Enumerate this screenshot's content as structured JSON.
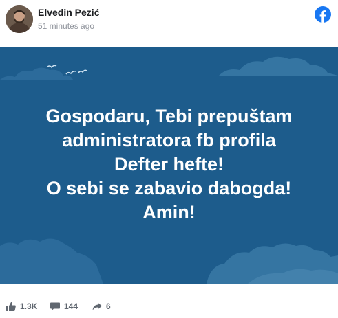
{
  "post": {
    "author": "Elvedin Pezić",
    "time": "51 minutes ago",
    "text_lines": [
      "Gospodaru, Tebi prepuštam",
      "administratora fb profila",
      "Defter hefte!",
      "O sebi se zabavio dabogda!",
      "Amin!"
    ],
    "background_color": "#1d5c8c"
  },
  "stats": {
    "likes": "1.3K",
    "comments": "144",
    "shares": "6"
  },
  "icons": {
    "brand": "facebook-icon",
    "like": "thumbs-up-icon",
    "comment": "comment-icon",
    "share": "share-arrow-icon"
  },
  "colors": {
    "facebook_blue": "#1877f2",
    "stats_gray": "#606770"
  }
}
